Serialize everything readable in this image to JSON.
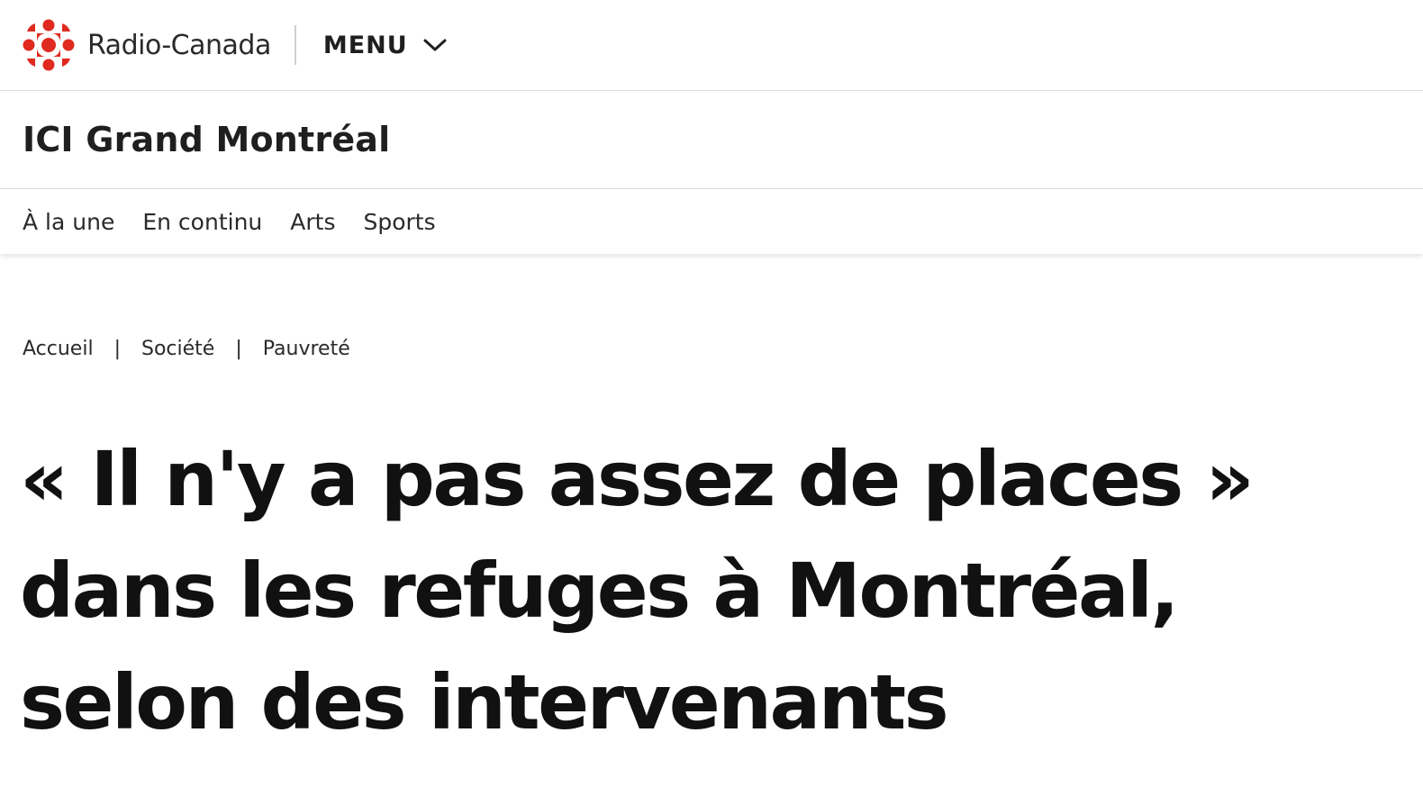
{
  "header": {
    "logo_text": "Radio-Canada",
    "menu_label": "MENU"
  },
  "section": {
    "title": "ICI Grand Montréal"
  },
  "subnav": {
    "items": [
      {
        "label": "À la une"
      },
      {
        "label": "En continu"
      },
      {
        "label": "Arts"
      },
      {
        "label": "Sports"
      }
    ]
  },
  "breadcrumb": {
    "items": [
      {
        "label": "Accueil"
      },
      {
        "label": "Société"
      },
      {
        "label": "Pauvreté"
      }
    ],
    "separator": "|"
  },
  "article": {
    "headline": "« Il n'y a pas assez de places » dans les refuges à Montréal, selon des intervenants"
  },
  "colors": {
    "brand_red": "#e0291f",
    "text": "#111111",
    "divider": "#dcdcdc"
  },
  "icons": {
    "logo": "radio-canada-gem-icon",
    "menu": "chevron-down-icon"
  }
}
